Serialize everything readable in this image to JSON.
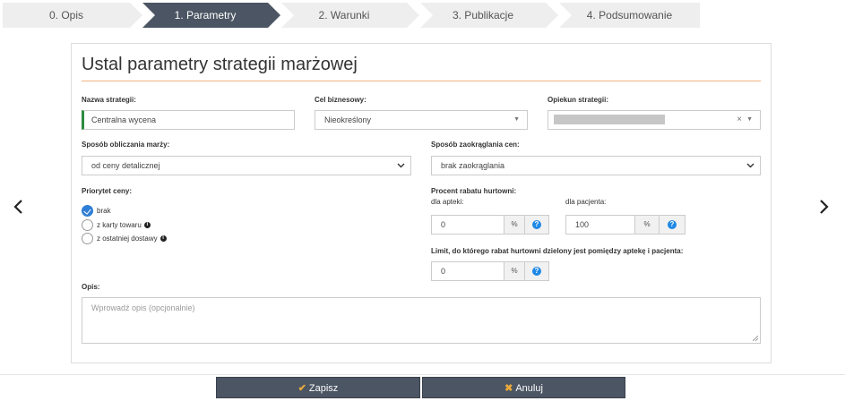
{
  "wizard": {
    "steps": [
      {
        "label": "0. Opis"
      },
      {
        "label": "1. Parametry"
      },
      {
        "label": "2. Warunki"
      },
      {
        "label": "3. Publikacje"
      },
      {
        "label": "4. Podsumowanie"
      }
    ],
    "active_step": 1
  },
  "form": {
    "title": "Ustal parametry strategii marżowej",
    "strategy_name": {
      "label": "Nazwa strategii:",
      "value": "Centralna wycena"
    },
    "business_goal": {
      "label": "Cel biznesowy:",
      "value": "Nieokreślony"
    },
    "strategy_owner": {
      "label": "Opiekun strategii:",
      "clear": "×"
    },
    "margin_method": {
      "label": "Sposób obliczania marży:",
      "value": "od ceny detalicznej"
    },
    "rounding": {
      "label": "Sposób zaokrąglania cen:",
      "value": "brak zaokrąglania"
    },
    "price_priority": {
      "label": "Priorytet ceny:",
      "options": [
        {
          "label": "brak",
          "checked": true,
          "info": false
        },
        {
          "label": "z karty towaru",
          "checked": false,
          "info": true
        },
        {
          "label": "z ostatniej dostawy",
          "checked": false,
          "info": true
        }
      ]
    },
    "wholesale_discount": {
      "label": "Procent rabatu hurtowni:",
      "pharmacy": {
        "label": "dla apteki:",
        "value": "0",
        "unit": "%"
      },
      "patient": {
        "label": "dla pacjenta:",
        "value": "100",
        "unit": "%"
      }
    },
    "limit": {
      "label": "Limit, do którego rabat hurtowni dzielony jest pomiędzy aptekę i pacjenta:",
      "value": "0",
      "unit": "%"
    },
    "description": {
      "label": "Opis:",
      "placeholder": "Wprowadź opis (opcjonalnie)"
    }
  },
  "buttons": {
    "save": "Zapisz",
    "cancel": "Anuluj"
  },
  "colors": {
    "active_step": "#4b5563",
    "accent_rule": "#f0b37e",
    "valid_border": "#2e8b3e",
    "help_icon": "#1e88e5",
    "button_icon": "#e9a93a"
  },
  "icons": {
    "prev": "chevron-left-icon",
    "next": "chevron-right-icon",
    "help": "question-circle-icon",
    "info": "info-circle-icon",
    "save": "check-icon",
    "cancel": "close-icon"
  }
}
